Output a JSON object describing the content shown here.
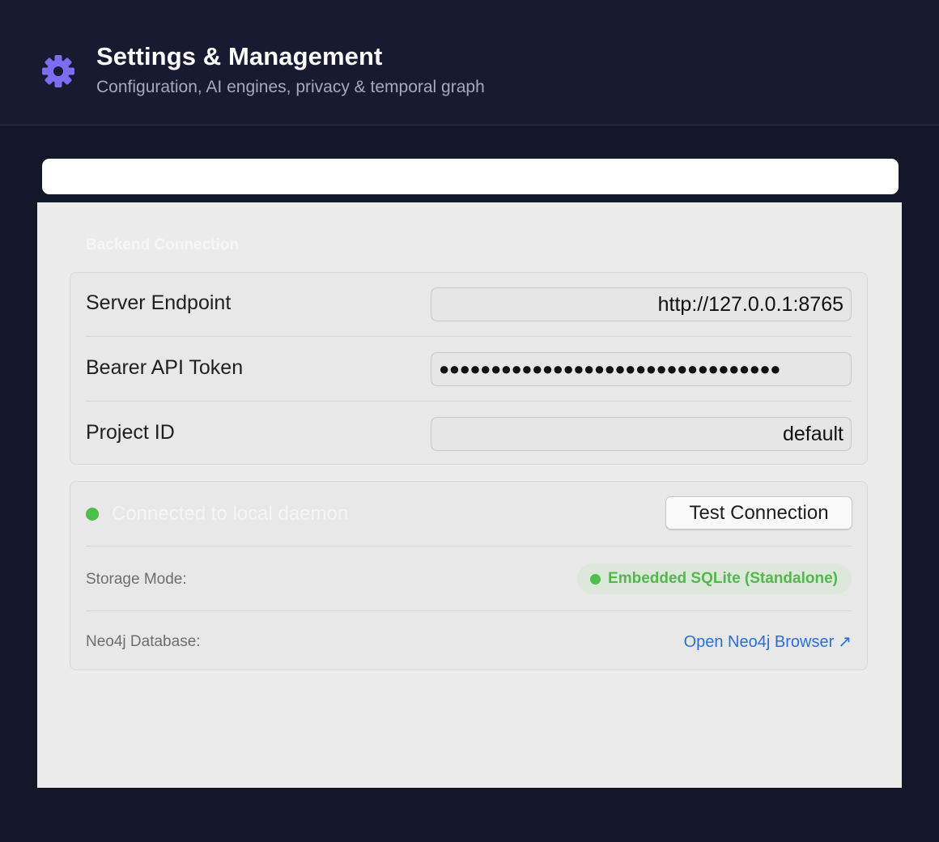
{
  "header": {
    "title": "Settings & Management",
    "subtitle": "Configuration, AI engines, privacy & temporal graph",
    "icon": "gear-icon",
    "accent_color": "#7b6cf0"
  },
  "section": {
    "title": "Backend Connection"
  },
  "form": {
    "endpoint": {
      "label": "Server Endpoint",
      "value": "http://127.0.0.1:8765"
    },
    "token": {
      "label": "Bearer API Token",
      "value": "●●●●●●●●●●●●●●●●●●●●●●●●●●●●●●●●●"
    },
    "project": {
      "label": "Project ID",
      "value": "default"
    }
  },
  "status": {
    "text": "Connected to local daemon",
    "color": "#4fbe4a",
    "test_button": "Test Connection",
    "storage_label": "Storage Mode:",
    "storage_value": "Embedded SQLite (Standalone)",
    "neo4j_label": "Neo4j Database:",
    "neo4j_link": "Open Neo4j Browser",
    "neo4j_link_icon": "↗"
  }
}
